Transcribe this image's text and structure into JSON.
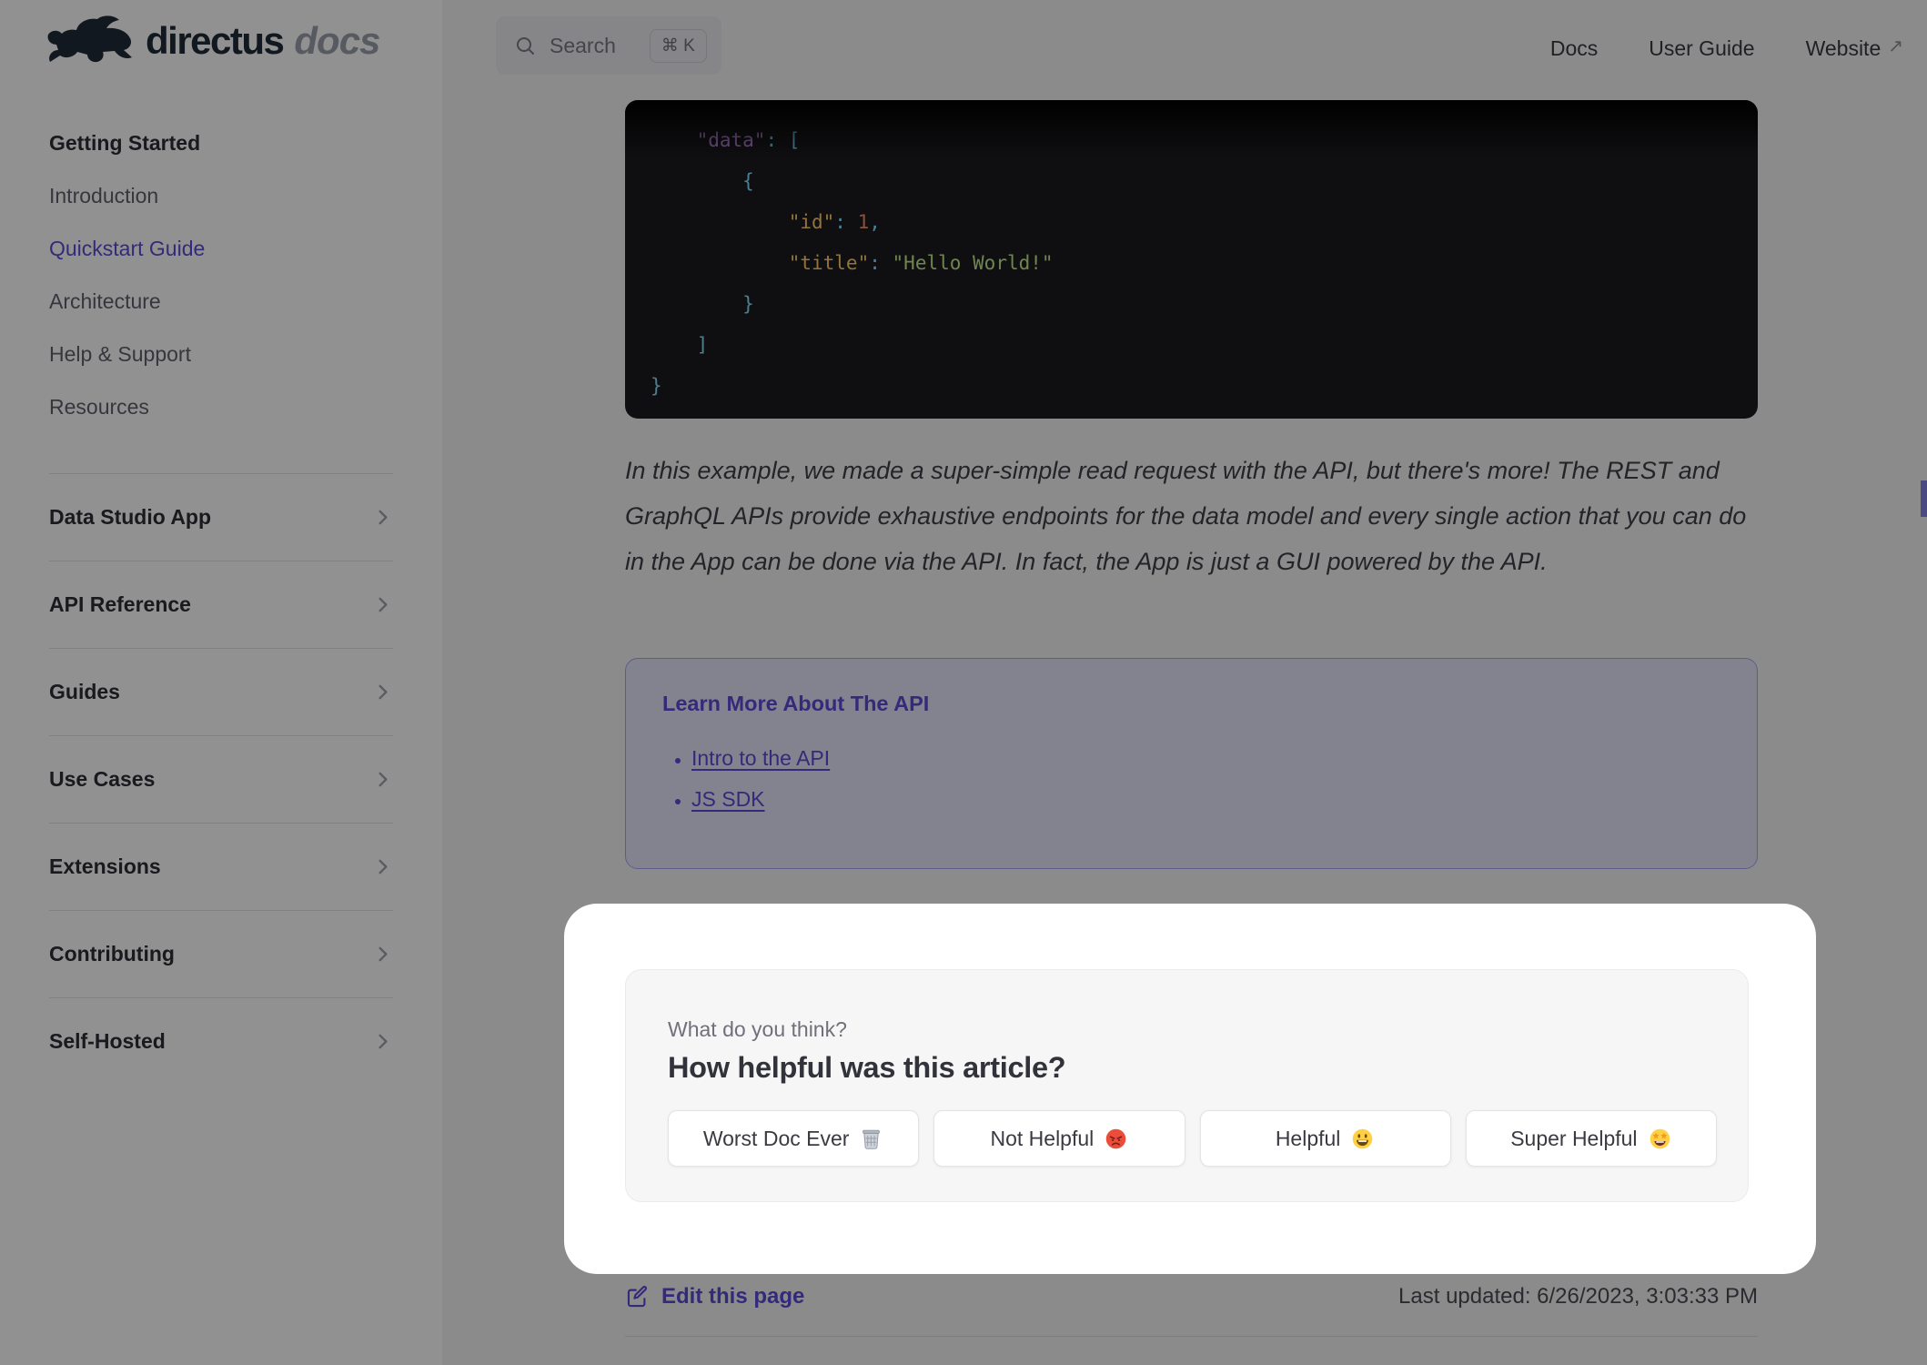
{
  "brand": {
    "name": "directus",
    "suffix": "docs"
  },
  "topnav": {
    "search": {
      "label": "Search",
      "shortcut": "⌘ K"
    },
    "links": [
      {
        "label": "Docs",
        "external": false
      },
      {
        "label": "User Guide",
        "external": false
      },
      {
        "label": "Website",
        "external": true
      }
    ]
  },
  "sidebar": {
    "top_items": [
      {
        "label": "Getting Started",
        "bold": true
      },
      {
        "label": "Introduction"
      },
      {
        "label": "Quickstart Guide",
        "active": true
      },
      {
        "label": "Architecture"
      },
      {
        "label": "Help & Support"
      },
      {
        "label": "Resources"
      }
    ],
    "sections": [
      {
        "label": "Data Studio App"
      },
      {
        "label": "API Reference"
      },
      {
        "label": "Guides"
      },
      {
        "label": "Use Cases"
      },
      {
        "label": "Extensions"
      },
      {
        "label": "Contributing"
      },
      {
        "label": "Self-Hosted"
      }
    ]
  },
  "content": {
    "code": {
      "lines": [
        [
          {
            "t": "    "
          },
          {
            "t": "\"data\"",
            "c": "prop"
          },
          {
            "t": ": ",
            "c": "punct"
          },
          {
            "t": "[",
            "c": "punct"
          }
        ],
        [
          {
            "t": "        "
          },
          {
            "t": "{",
            "c": "punct"
          }
        ],
        [
          {
            "t": "            "
          },
          {
            "t": "\"id\"",
            "c": "key"
          },
          {
            "t": ": ",
            "c": "punct"
          },
          {
            "t": "1",
            "c": "num"
          },
          {
            "t": ",",
            "c": "punct"
          }
        ],
        [
          {
            "t": "            "
          },
          {
            "t": "\"title\"",
            "c": "key"
          },
          {
            "t": ": ",
            "c": "punct"
          },
          {
            "t": "\"Hello World!\"",
            "c": "str"
          }
        ],
        [
          {
            "t": "        "
          },
          {
            "t": "}",
            "c": "punct"
          }
        ],
        [
          {
            "t": "    "
          },
          {
            "t": "]",
            "c": "punct"
          }
        ],
        [
          {
            "t": "}",
            "c": "punct"
          }
        ]
      ]
    },
    "paragraph": "In this example, we made a super-simple read request with the API, but there's more! The REST and GraphQL APIs provide exhaustive endpoints for the data model and every single action that you can do in the App can be done via the API. In fact, the App is just a GUI powered by the API.",
    "learn_more": {
      "title": "Learn More About The API",
      "links": [
        {
          "label": "Intro to the API"
        },
        {
          "label": "JS SDK"
        }
      ]
    },
    "footer": {
      "edit_label": "Edit this page",
      "last_updated": "Last updated: 6/26/2023, 3:03:33 PM"
    }
  },
  "feedback": {
    "kicker": "What do you think?",
    "title": "How helpful was this article?",
    "buttons": [
      {
        "label": "Worst Doc Ever",
        "emoji": "🗑️",
        "icon": "trash-emoji"
      },
      {
        "label": "Not Helpful",
        "emoji": "😡",
        "icon": "angry-face-emoji"
      },
      {
        "label": "Helpful",
        "emoji": "😃",
        "icon": "smiling-face-emoji"
      },
      {
        "label": "Super Helpful",
        "emoji": "🤩",
        "icon": "star-struck-emoji"
      }
    ]
  },
  "colors": {
    "accent": "#5a4ad6",
    "scrollbar": "#8480e4",
    "logo_ink": "#212b39",
    "tip_bg": "#e6e5fb",
    "tip_border": "#a7a2f3",
    "code_bg": "#1b1b1f",
    "code_prop": "#c792ea",
    "code_key": "#ffcb6b",
    "code_num": "#f78c6c",
    "code_str": "#c3e88d",
    "code_punct": "#89ddff"
  }
}
